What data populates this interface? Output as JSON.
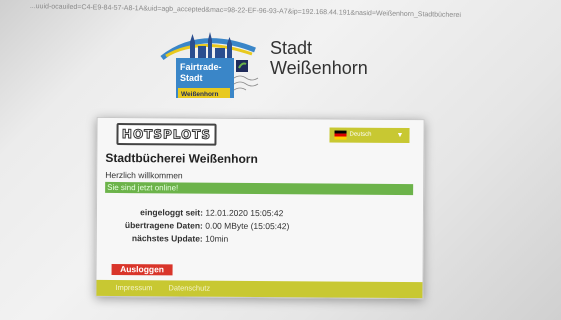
{
  "browser": {
    "url": "...uuid-ocauiled=C4-E9-84-57-A8-1A&uid=agb_accepted&mac=98-22-EF-96-93-A7&ip=192.168.44.191&nasid=Weißenhorn_Stadtbücherei"
  },
  "header": {
    "logo_line1": "Fairtrade-",
    "logo_line2": "Stadt",
    "logo_city": "Weißenhorn",
    "city_line1": "Stadt",
    "city_line2": "Weißenhorn"
  },
  "card": {
    "brand": "HOTSPLOTS",
    "language": {
      "selected": "Deutsch"
    },
    "title": "Stadtbücherei Weißenhorn",
    "welcome": "Herzlich willkommen",
    "status": "Sie sind jetzt online!",
    "rows": [
      {
        "label": "eingeloggt seit:",
        "value": "12.01.2020 15:05:42"
      },
      {
        "label": "übertragene Daten:",
        "value": "0.00 MByte (15:05:42)"
      },
      {
        "label": "nächstes Update:",
        "value": "10min"
      }
    ],
    "logout_label": "Ausloggen",
    "footer": {
      "impressum": "Impressum",
      "datenschutz": "Datenschutz"
    }
  },
  "colors": {
    "accent": "#c8c832",
    "online": "#6cb34a",
    "logout": "#d9352a"
  }
}
